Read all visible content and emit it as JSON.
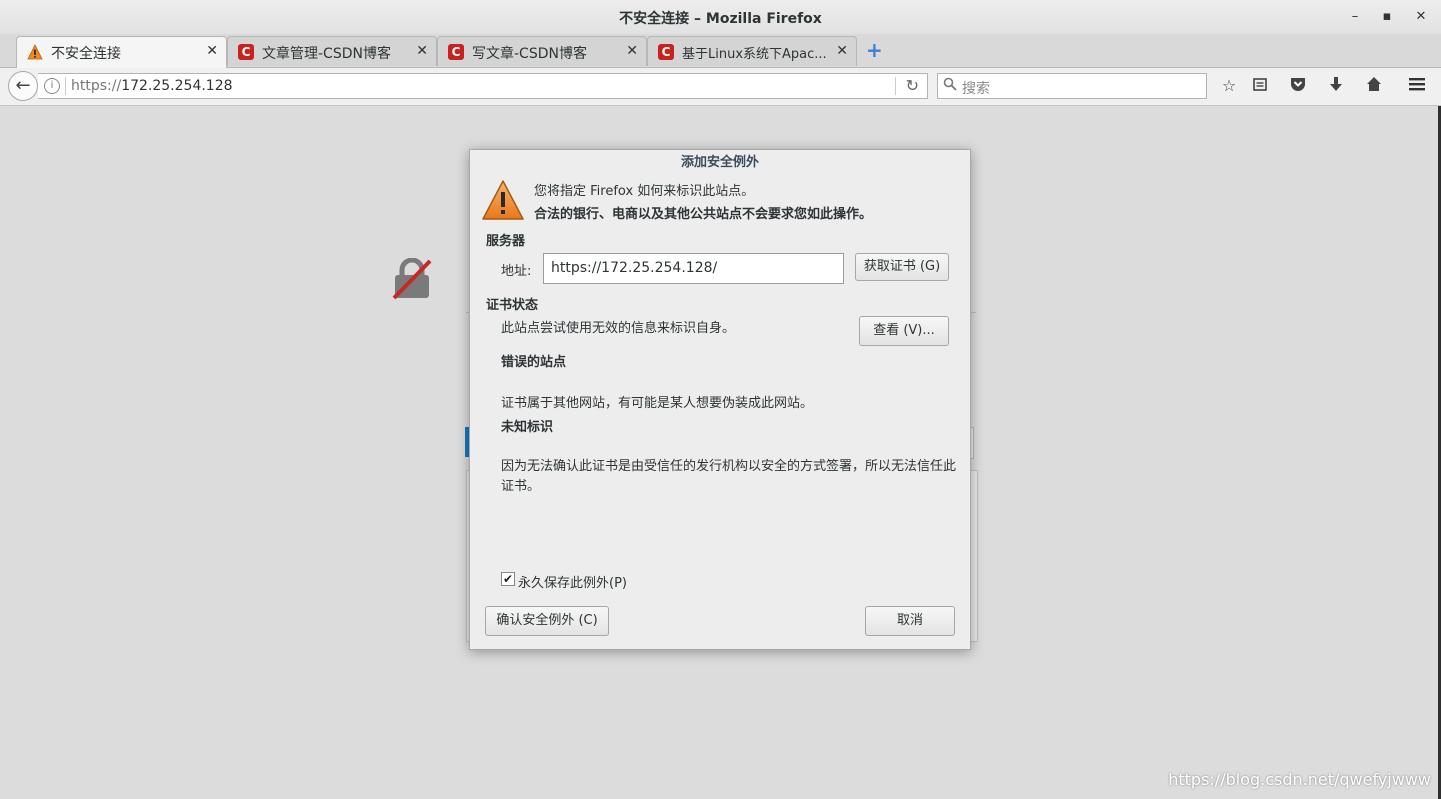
{
  "window": {
    "title": "不安全连接 – Mozilla Firefox",
    "controls": {
      "minimize": "–",
      "maximize": "▪",
      "close": "✕"
    }
  },
  "tabs": [
    {
      "label": "不安全连接",
      "icon": "warning-icon",
      "active": true
    },
    {
      "label": "文章管理-CSDN博客",
      "icon": "csdn-icon",
      "active": false
    },
    {
      "label": "写文章-CSDN博客",
      "icon": "csdn-icon",
      "active": false
    },
    {
      "label": "基于Linux系统下Apac...",
      "icon": "csdn-icon",
      "active": false
    }
  ],
  "tab_close": "✕",
  "navbar": {
    "url_protocol": "https://",
    "url_host": "172.25.254.128",
    "search_placeholder": "搜索"
  },
  "page": {
    "watermark": "https://blog.csdn.net/qwefyjwww"
  },
  "dialog": {
    "title": "添加安全例外",
    "intro_line1": "您将指定 Firefox 如何来标识此站点。",
    "intro_line2": "合法的银行、电商以及其他公共站点不会要求您如此操作。",
    "server_heading": "服务器",
    "address_label": "地址:",
    "address_value": "https://172.25.254.128/",
    "get_cert_button": "获取证书 (G)",
    "cert_status_heading": "证书状态",
    "cert_status_desc": "此站点尝试使用无效的信息来标识自身。",
    "view_button": "查看 (V)...",
    "wrong_site_heading": "错误的站点",
    "wrong_site_desc": "证书属于其他网站，有可能是某人想要伪装成此网站。",
    "unknown_id_heading": "未知标识",
    "unknown_id_desc": "因为无法确认此证书是由受信任的发行机构以安全的方式签署，所以无法信任此证书。",
    "permanent_checkbox_label": "永久保存此例外(P)",
    "permanent_checked": true,
    "confirm_button": "确认安全例外 (C)",
    "cancel_button": "取消"
  },
  "colors": {
    "accent": "#1a78c2",
    "csdn_red": "#c9211e",
    "warning_orange": "#f08a24"
  }
}
